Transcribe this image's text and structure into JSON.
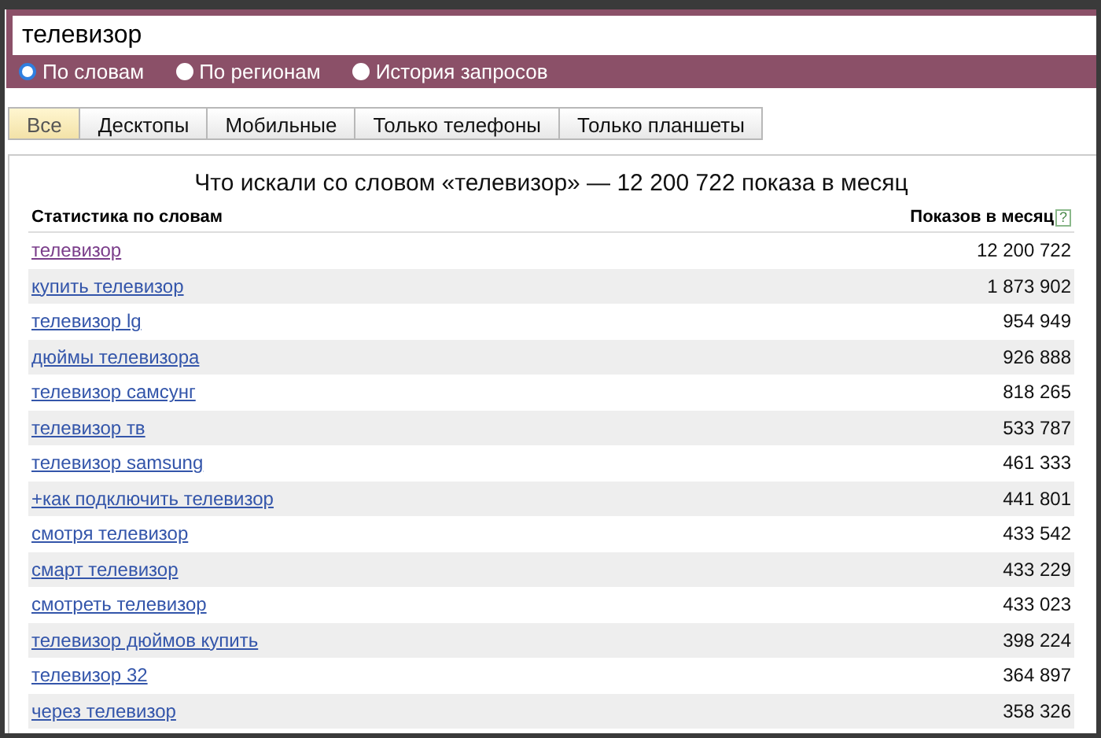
{
  "search": {
    "value": "телевизор"
  },
  "modes": [
    {
      "label": "По словам",
      "selected": true
    },
    {
      "label": "По регионам",
      "selected": false
    },
    {
      "label": "История запросов",
      "selected": false
    }
  ],
  "tabs": [
    {
      "label": "Все",
      "selected": true
    },
    {
      "label": "Десктопы",
      "selected": false
    },
    {
      "label": "Мобильные",
      "selected": false
    },
    {
      "label": "Только телефоны",
      "selected": false
    },
    {
      "label": "Только планшеты",
      "selected": false
    }
  ],
  "table": {
    "title": "Что искали со словом «телевизор» — 12 200 722 показа в месяц",
    "columns": [
      "Статистика по словам",
      "Показов в месяц"
    ],
    "help": "?",
    "rows": [
      {
        "phrase": "телевизор",
        "count": "12 200 722",
        "visited": true
      },
      {
        "phrase": "купить телевизор",
        "count": "1 873 902",
        "visited": false
      },
      {
        "phrase": "телевизор lg",
        "count": "954 949",
        "visited": false
      },
      {
        "phrase": "дюймы телевизора",
        "count": "926 888",
        "visited": false
      },
      {
        "phrase": "телевизор самсунг",
        "count": "818 265",
        "visited": false
      },
      {
        "phrase": "телевизор тв",
        "count": "533 787",
        "visited": false
      },
      {
        "phrase": "телевизор samsung",
        "count": "461 333",
        "visited": false
      },
      {
        "phrase": "+как подключить телевизор",
        "count": "441 801",
        "visited": false
      },
      {
        "phrase": "смотря телевизор",
        "count": "433 542",
        "visited": false
      },
      {
        "phrase": "смарт телевизор",
        "count": "433 229",
        "visited": false
      },
      {
        "phrase": "смотреть телевизор",
        "count": "433 023",
        "visited": false
      },
      {
        "phrase": "телевизор дюймов купить",
        "count": "398 224",
        "visited": false
      },
      {
        "phrase": "телевизор 32",
        "count": "364 897",
        "visited": false
      },
      {
        "phrase": "через телевизор",
        "count": "358 326",
        "visited": false
      }
    ]
  }
}
